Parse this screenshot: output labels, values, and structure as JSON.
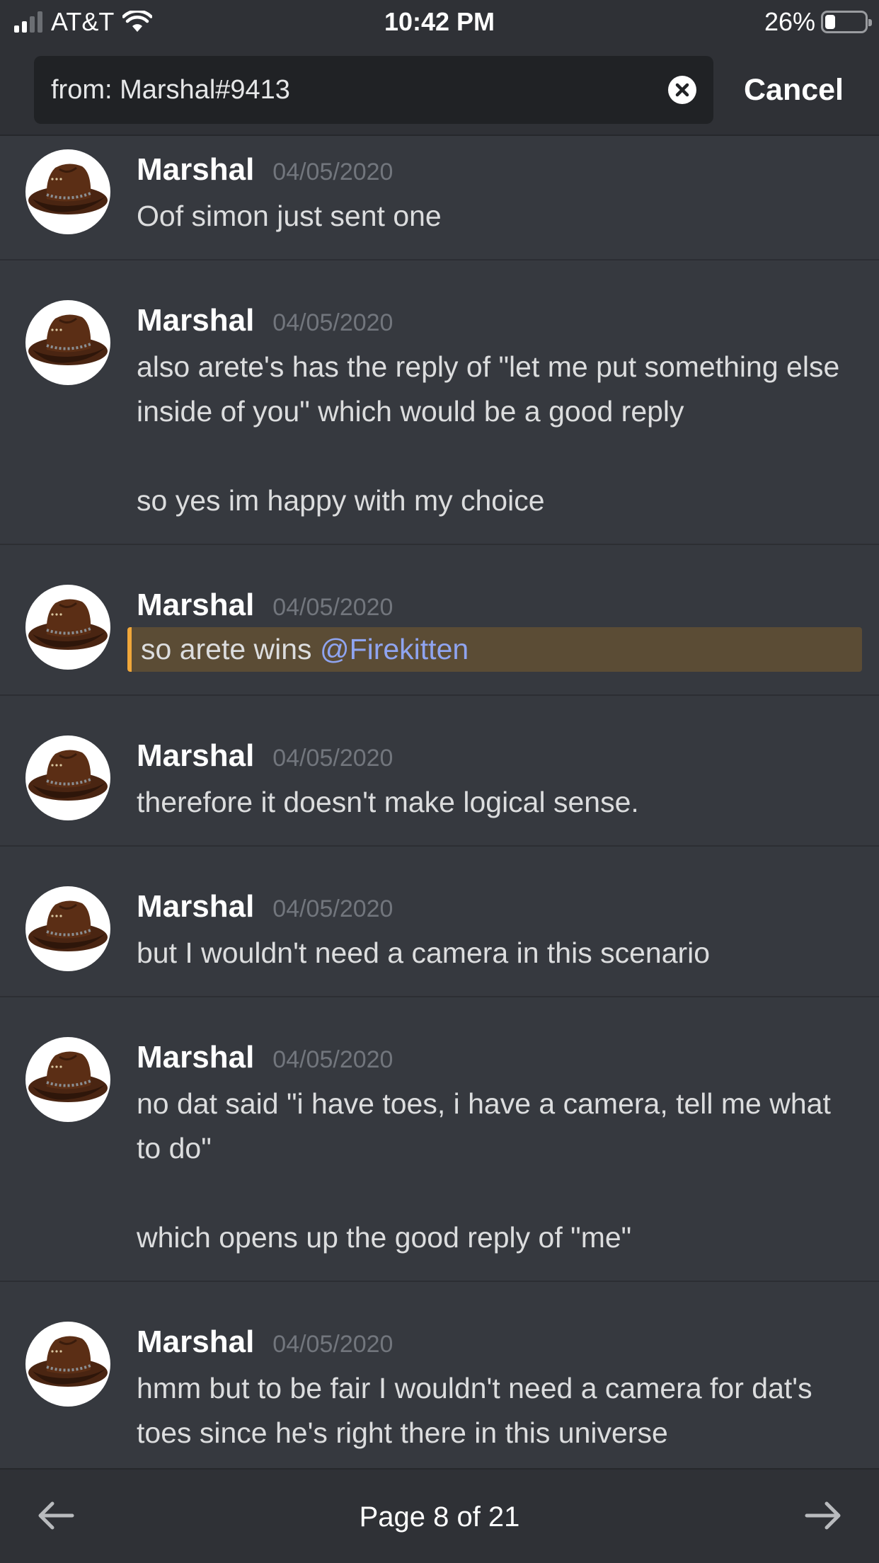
{
  "status_bar": {
    "carrier": "AT&T",
    "time": "10:42 PM",
    "battery_percent": "26%",
    "battery_level": 0.26,
    "signal_bars": 2,
    "icons": [
      "signal-icon",
      "wifi-icon",
      "battery-icon"
    ]
  },
  "search": {
    "query": "from: Marshal#9413",
    "clear_icon": "clear-x-icon",
    "cancel_label": "Cancel"
  },
  "messages": [
    {
      "author": "Marshal",
      "timestamp": "04/05/2020",
      "text": "Oof simon just sent one"
    },
    {
      "author": "Marshal",
      "timestamp": "04/05/2020",
      "text": "also arete's has the reply of \"let me put something else inside of you\" which would be a good reply\n\nso yes im happy with my choice"
    },
    {
      "author": "Marshal",
      "timestamp": "04/05/2020",
      "text": "so arete wins ",
      "mention": "@Firekitten"
    },
    {
      "author": "Marshal",
      "timestamp": "04/05/2020",
      "text": "therefore it doesn't make logical sense."
    },
    {
      "author": "Marshal",
      "timestamp": "04/05/2020",
      "text": "but I wouldn't need a camera in this scenario"
    },
    {
      "author": "Marshal",
      "timestamp": "04/05/2020",
      "text": "no dat said \"i have toes, i have a camera, tell me what to do\"\n\nwhich opens up the good reply of \"me\""
    },
    {
      "author": "Marshal",
      "timestamp": "04/05/2020",
      "text": "hmm but to be fair I wouldn't need a camera for dat's toes since he's right there in this universe"
    }
  ],
  "pagination": {
    "label": "Page 8 of 21",
    "prev_icon": "arrow-left-icon",
    "next_icon": "arrow-right-icon"
  },
  "colors": {
    "background": "#36393f",
    "header": "#2f3136",
    "search_box": "#202225",
    "mention": "#8fa4f0",
    "highlight_bg": "#5b4c35",
    "highlight_bar": "#f0a73a",
    "timestamp": "#72767d"
  }
}
